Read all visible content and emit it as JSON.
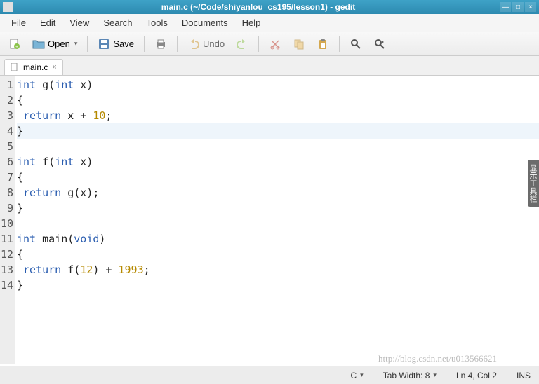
{
  "titlebar": {
    "title": "main.c (~/Code/shiyanlou_cs195/lesson1) - gedit",
    "min": "—",
    "max": "□",
    "close": "×"
  },
  "menubar": [
    "File",
    "Edit",
    "View",
    "Search",
    "Tools",
    "Documents",
    "Help"
  ],
  "toolbar": {
    "open": "Open",
    "save": "Save",
    "undo": "Undo"
  },
  "tab": {
    "name": "main.c",
    "close": "×"
  },
  "code": {
    "lines": [
      {
        "n": "1",
        "tokens": [
          [
            "kw",
            "int"
          ],
          [
            "",
            " g("
          ],
          [
            "kw",
            "int"
          ],
          [
            "",
            " x)"
          ]
        ]
      },
      {
        "n": "2",
        "tokens": [
          [
            "",
            "{"
          ]
        ]
      },
      {
        "n": "3",
        "tokens": [
          [
            "",
            " "
          ],
          [
            "kw",
            "return"
          ],
          [
            "",
            " x + "
          ],
          [
            "num",
            "10"
          ],
          [
            "",
            ";"
          ]
        ]
      },
      {
        "n": "4",
        "tokens": [
          [
            "",
            "}"
          ]
        ],
        "current": true
      },
      {
        "n": "5",
        "tokens": []
      },
      {
        "n": "6",
        "tokens": [
          [
            "kw",
            "int"
          ],
          [
            "",
            " f("
          ],
          [
            "kw",
            "int"
          ],
          [
            "",
            " x)"
          ]
        ]
      },
      {
        "n": "7",
        "tokens": [
          [
            "",
            "{"
          ]
        ]
      },
      {
        "n": "8",
        "tokens": [
          [
            "",
            " "
          ],
          [
            "kw",
            "return"
          ],
          [
            "",
            " g(x);"
          ]
        ]
      },
      {
        "n": "9",
        "tokens": [
          [
            "",
            "}"
          ]
        ]
      },
      {
        "n": "10",
        "tokens": []
      },
      {
        "n": "11",
        "tokens": [
          [
            "kw",
            "int"
          ],
          [
            "",
            " main("
          ],
          [
            "kw",
            "void"
          ],
          [
            "",
            ")"
          ]
        ]
      },
      {
        "n": "12",
        "tokens": [
          [
            "",
            "{"
          ]
        ]
      },
      {
        "n": "13",
        "tokens": [
          [
            "",
            " "
          ],
          [
            "kw",
            "return"
          ],
          [
            "",
            " f("
          ],
          [
            "num",
            "12"
          ],
          [
            "",
            ") + "
          ],
          [
            "num",
            "1993"
          ],
          [
            "",
            ";"
          ]
        ]
      },
      {
        "n": "14",
        "tokens": [
          [
            "",
            "}"
          ]
        ]
      }
    ]
  },
  "sidebar_handle": "显示工具栏",
  "statusbar": {
    "lang": "C",
    "tabwidth": "Tab Width: 8",
    "position": "Ln 4, Col 2",
    "mode": "INS"
  },
  "watermark": "http://blog.csdn.net/u013566621"
}
